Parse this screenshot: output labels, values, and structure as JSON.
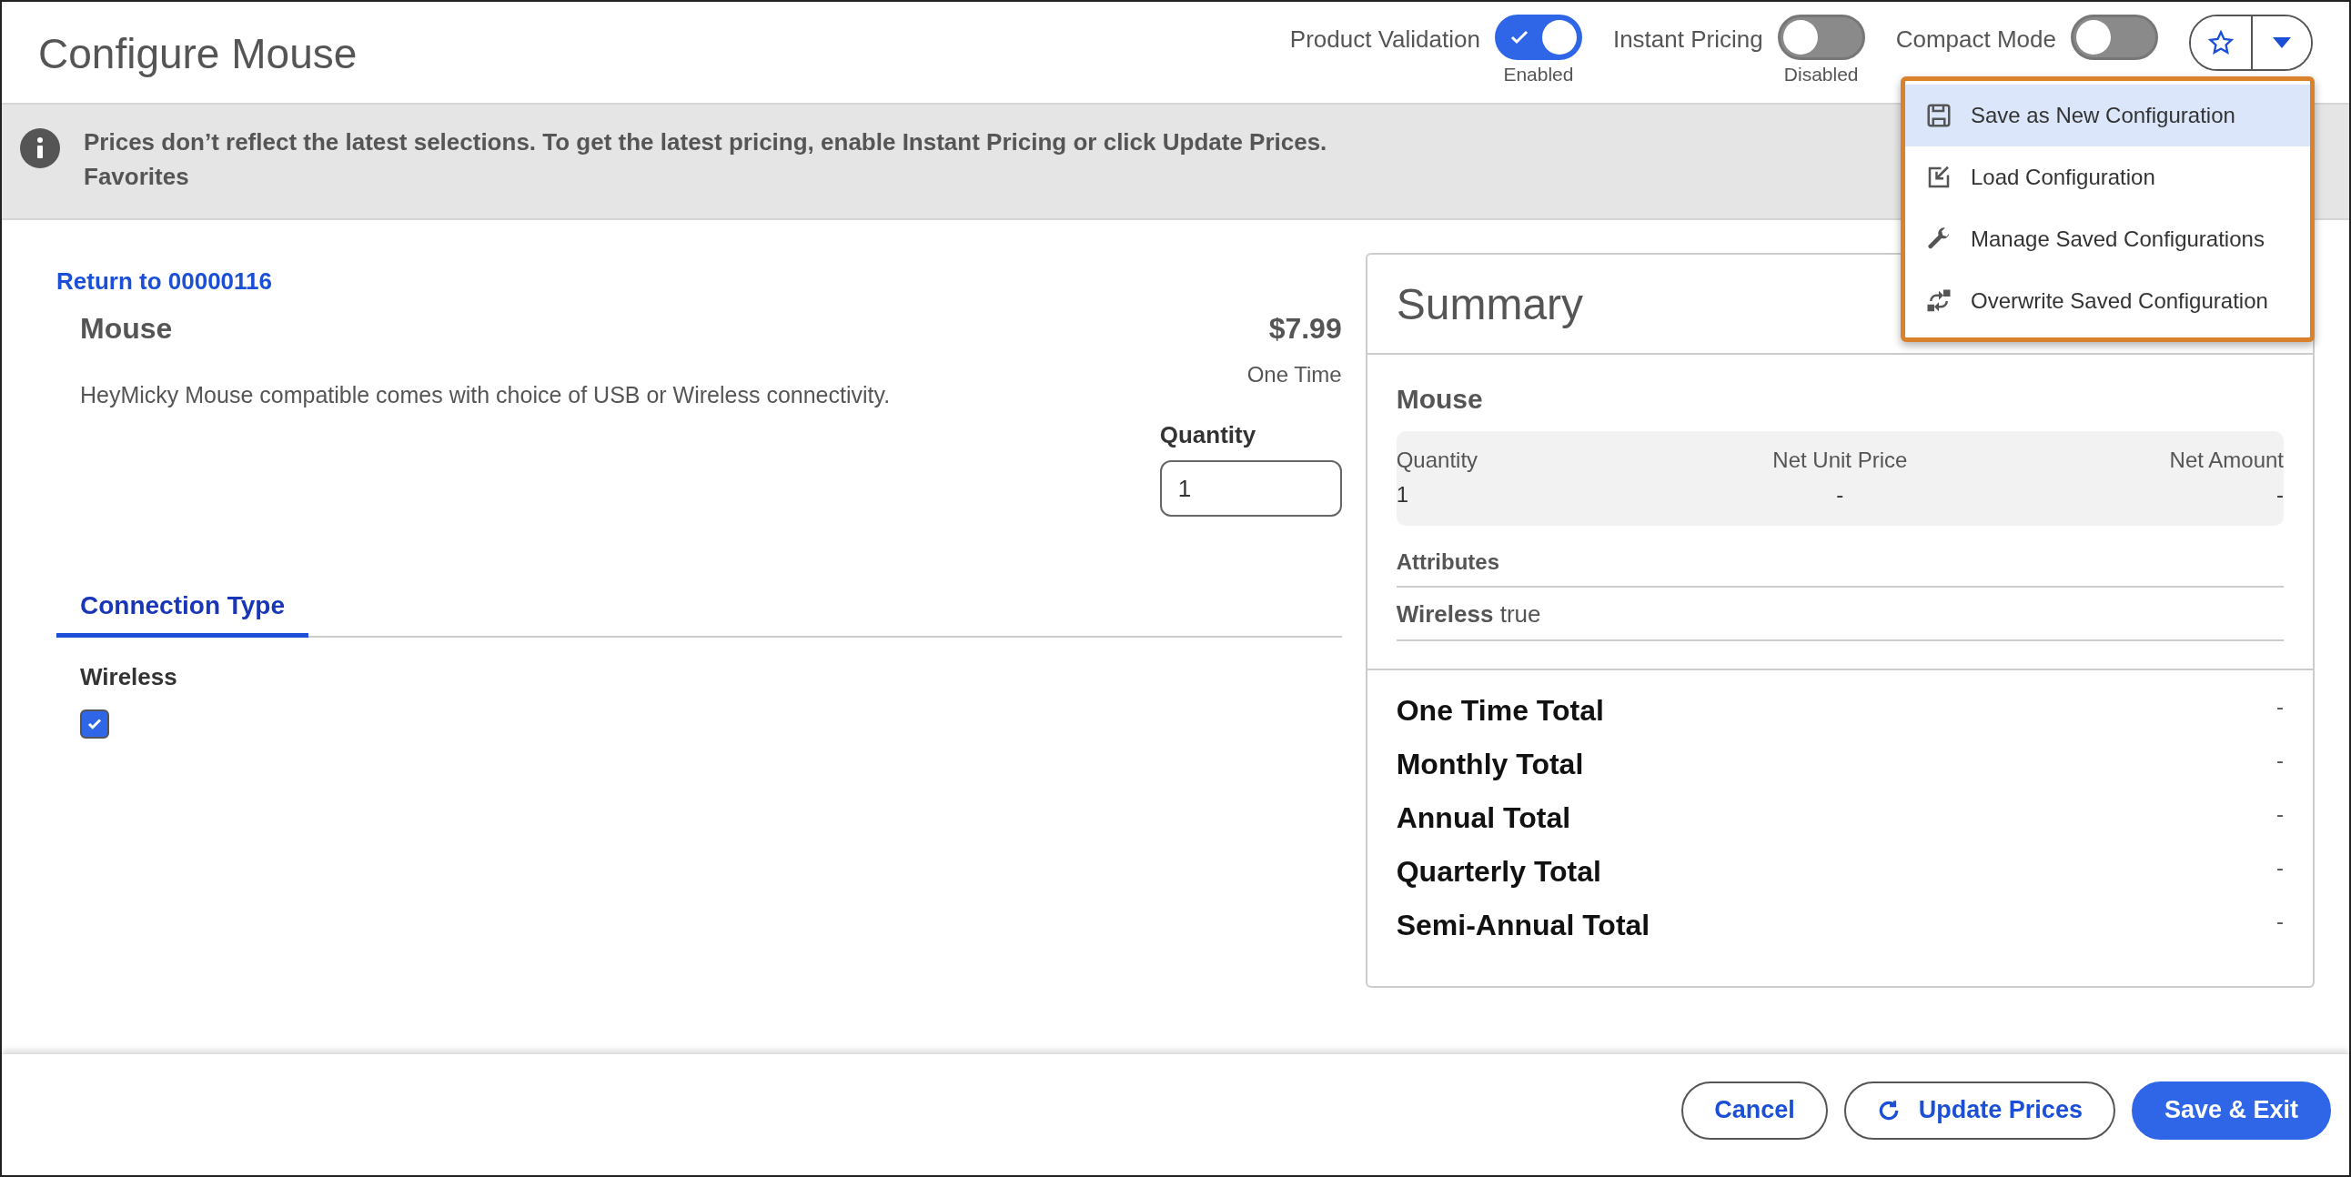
{
  "header": {
    "title": "Configure Mouse",
    "toggles": [
      {
        "label": "Product Validation",
        "on": true,
        "caption": "Enabled"
      },
      {
        "label": "Instant Pricing",
        "on": false,
        "caption": "Disabled"
      },
      {
        "label": "Compact Mode",
        "on": false
      }
    ]
  },
  "favorites_menu": {
    "items": [
      {
        "label": "Save as New Configuration",
        "selected": true
      },
      {
        "label": "Load Configuration",
        "selected": false
      },
      {
        "label": "Manage Saved Configurations",
        "selected": false
      },
      {
        "label": "Overwrite Saved Configuration",
        "selected": false
      }
    ]
  },
  "banner": {
    "message": "Prices don’t reflect the latest selections. To get the latest pricing, enable Instant Pricing or click Update Prices.",
    "second_line": "Favorites"
  },
  "product": {
    "return_link": "Return to 00000116",
    "name": "Mouse",
    "price": "$7.99",
    "price_type": "One Time",
    "description": "HeyMicky Mouse compatible comes with choice of USB or Wireless connectivity.",
    "quantity_label": "Quantity",
    "quantity_value": "1"
  },
  "tabs": [
    {
      "label": "Connection Type",
      "selected": true
    }
  ],
  "attributes": [
    {
      "label": "Wireless",
      "checked": true
    }
  ],
  "summary": {
    "title": "Summary",
    "product": "Mouse",
    "columns": [
      {
        "label": "Quantity",
        "value": "1"
      },
      {
        "label": "Net Unit Price",
        "value": "-"
      },
      {
        "label": "Net Amount",
        "value": "-"
      }
    ],
    "attributes_heading": "Attributes",
    "attributes": [
      {
        "name": "Wireless",
        "value": "true"
      }
    ],
    "totals": [
      {
        "label": "One Time Total",
        "value": "-"
      },
      {
        "label": "Monthly Total",
        "value": "-"
      },
      {
        "label": "Annual Total",
        "value": "-"
      },
      {
        "label": "Quarterly Total",
        "value": "-"
      },
      {
        "label": "Semi-Annual Total",
        "value": "-"
      }
    ]
  },
  "footer": {
    "buttons": [
      {
        "label": "Cancel",
        "kind": "outline"
      },
      {
        "label": "Update Prices",
        "kind": "refresh"
      },
      {
        "label": "Save & Exit",
        "kind": "primary"
      }
    ]
  }
}
